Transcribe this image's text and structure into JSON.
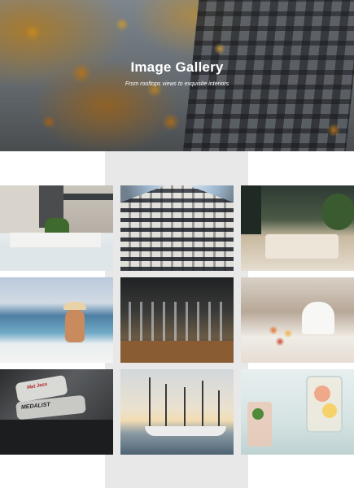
{
  "hero": {
    "title": "Image Gallery",
    "subtitle": "From rooftops views to exquisite interiors"
  },
  "gallery": {
    "tiles": [
      {
        "subject": "modern-house-pool"
      },
      {
        "subject": "building-looking-up"
      },
      {
        "subject": "lounge-with-plants"
      },
      {
        "subject": "infinity-pool-woman"
      },
      {
        "subject": "restaurant-glassware"
      },
      {
        "subject": "bartender-table"
      },
      {
        "subject": "golf-clubs",
        "text_1": "Mat Jess",
        "text_2": "MEDALIST"
      },
      {
        "subject": "sailboats-harbor"
      },
      {
        "subject": "citrus-drinks"
      }
    ]
  },
  "colors": {
    "page_background": "#ffffff",
    "column_background": "#e8e8e8",
    "hero_text": "#ffffff"
  }
}
